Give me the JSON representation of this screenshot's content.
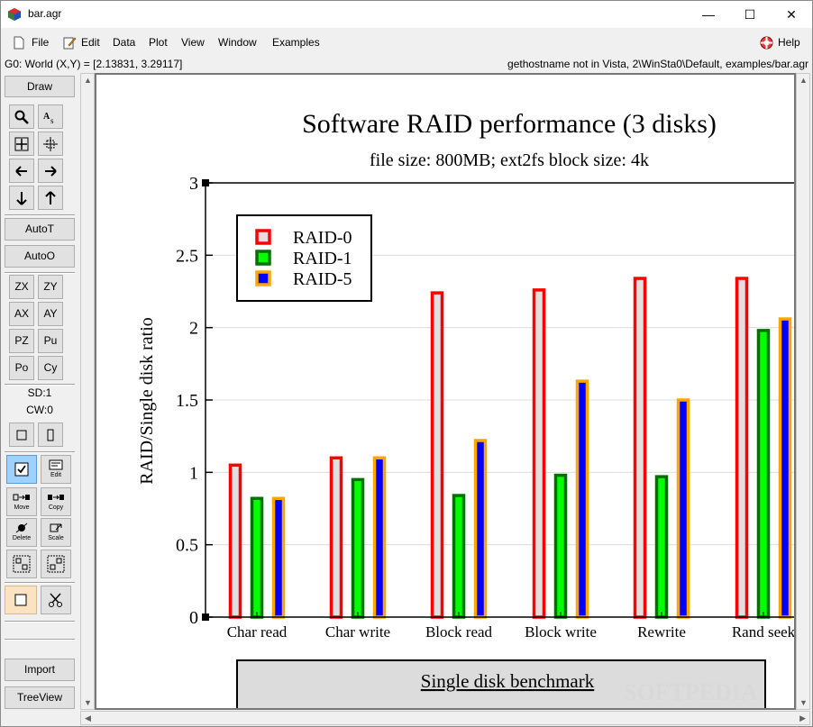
{
  "window": {
    "title": "bar.agr",
    "minimize": "—",
    "maximize": "☐",
    "close": "✕"
  },
  "menubar": {
    "items": [
      "File",
      "Edit",
      "Data",
      "Plot",
      "View",
      "Window",
      "Examples"
    ],
    "help": "Help"
  },
  "statusbar": {
    "left": "G0: World (X,Y) = [2.13831, 3.29117]",
    "right": "gethostname not in Vista, 2\\WinSta0\\Default, examples/bar.agr"
  },
  "toolbox": {
    "draw": "Draw",
    "autot": "AutoT",
    "autoo": "AutoO",
    "zoom_buttons": [
      "ZX",
      "ZY",
      "AX",
      "AY",
      "PZ",
      "Pu",
      "Po",
      "Cy"
    ],
    "sd": "SD:1",
    "cw": "CW:0",
    "edit_label": "Edit",
    "move_label": "Move",
    "copy_label": "Copy",
    "delete_label": "Delete",
    "scale_label": "Scale",
    "import": "Import",
    "treeview": "TreeView"
  },
  "chart_data": {
    "type": "bar",
    "title": "Software RAID performance (3 disks)",
    "subtitle": "file size: 800MB; ext2fs block size: 4k",
    "ylabel": "RAID/Single disk ratio",
    "xlabel_box": "Single disk benchmark",
    "ylim": [
      0,
      3
    ],
    "yticks": [
      "0",
      "0.5",
      "1",
      "1.5",
      "2",
      "2.5",
      "3"
    ],
    "grid": true,
    "legend_position": "top-left",
    "categories": [
      "Char read",
      "Char write",
      "Block read",
      "Block write",
      "Rewrite",
      "Rand seek"
    ],
    "series": [
      {
        "name": "RAID-0",
        "fill": "#e0e0e0",
        "stroke": "#ff0000",
        "values": [
          1.05,
          1.1,
          2.24,
          2.26,
          2.34,
          2.34
        ]
      },
      {
        "name": "RAID-1",
        "fill": "#00ff00",
        "stroke": "#007000",
        "values": [
          0.82,
          0.95,
          0.84,
          0.98,
          0.97,
          1.98
        ]
      },
      {
        "name": "RAID-5",
        "fill": "#0000ff",
        "stroke": "#ffa500",
        "values": [
          0.82,
          1.1,
          1.22,
          1.63,
          1.5,
          2.06
        ]
      }
    ]
  },
  "watermark": "SOFTPEDIA"
}
